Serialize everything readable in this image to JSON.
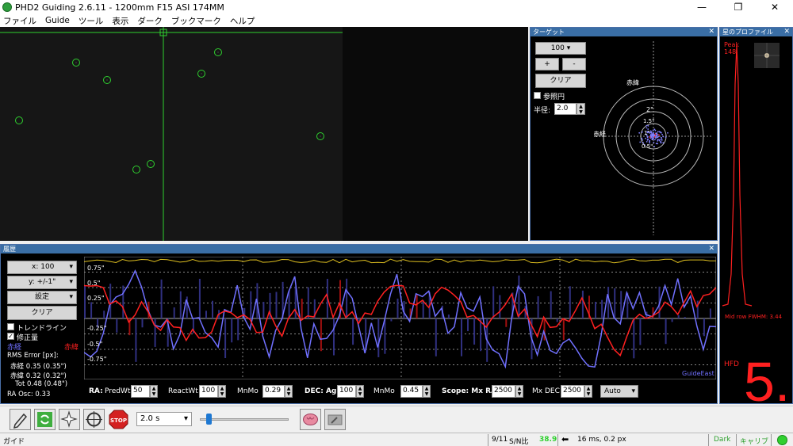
{
  "window": {
    "title": "PHD2 Guiding 2.6.11 - 1200mm F15 ASI 174MM",
    "minimize": "—",
    "restore": "❐",
    "close": "✕"
  },
  "menu": [
    "ファイル",
    "Guide",
    "ツール",
    "表示",
    "ダーク",
    "ブックマーク",
    "ヘルプ"
  ],
  "target_pane": {
    "title": "ターゲット",
    "scale_value": "100",
    "plus": "+",
    "minus": "-",
    "clear": "クリア",
    "ref_circle_label": "参照円",
    "radius_label": "半径:",
    "radius_value": "2.0",
    "dec_axis_label": "赤緯",
    "ra_axis_label": "赤経",
    "ring_labels": [
      "2\"",
      "1.5\"",
      "1\"",
      "0.5\""
    ]
  },
  "profile_pane": {
    "title": "星のプロファイル",
    "peak_label": "Peak",
    "peak_value": "148",
    "fwhm_label": "Mid row FWHM: 3.44",
    "hfd_label": "HFD",
    "hfd_value": "5."
  },
  "history_pane": {
    "title": "履歴",
    "x_scale": "x: 100",
    "y_scale": "y: +/-1\"",
    "settings": "設定",
    "clear": "クリア",
    "trend_label": "トレンドライン",
    "correction_label": "修正量",
    "ra_legend": "赤経",
    "dec_legend": "赤緯",
    "rms_title": "RMS Error [px]:",
    "rms_ra": "赤経  0.35 (0.35\")",
    "rms_dec": "赤緯  0.32 (0.32\")",
    "rms_tot": "Tot  0.48 (0.48\")",
    "ra_osc": "RA Osc: 0.33",
    "y_ticks": [
      "0.75\"",
      "0.5\"",
      "0.25\"",
      "-0.25\"",
      "-0.5\"",
      "-0.75\""
    ],
    "guide_direction": "GuideEast"
  },
  "params": {
    "ra_label": "RA:",
    "predwt_label": "PredWt",
    "predwt": "50",
    "reactwt_label": "ReactWt",
    "reactwt": "100",
    "mnmo_label": "MnMo",
    "mnmo_ra": "0.29",
    "dec_label": "DEC: Agr",
    "dec_agr": "100",
    "mnmo_dec": "0.45",
    "scope_label": "Scope: Mx RA",
    "mx_ra": "2500",
    "mx_dec_label": "Mx DEC",
    "mx_dec": "2500",
    "dec_mode": "Auto"
  },
  "toolbar": {
    "exposure": "2.0 s",
    "stop": "STOP",
    "exposure_slider": 0.08
  },
  "status": {
    "mode": "ガイド",
    "frame": "9/11",
    "snr_label": "S/N比",
    "snr_value": "38.9",
    "pulse": "16 ms, 0.2 px",
    "dark": "Dark",
    "calib": "キャリブ"
  },
  "colors": {
    "ra": "#ff2020",
    "dec": "#7070ff",
    "grid": "#ffffff",
    "accent_green": "#2fd02f",
    "snr": "#2fd02f"
  }
}
